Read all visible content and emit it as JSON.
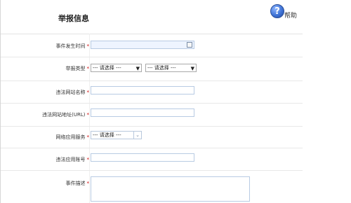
{
  "header": {
    "title": "举报信息",
    "help_icon": "help-circle-icon",
    "help_label": "帮助"
  },
  "form": {
    "required_mark": "*",
    "event_time": {
      "label": "事件发生时间",
      "value": "",
      "icon": "calendar-icon"
    },
    "report_type": {
      "label": "举报类型",
      "selected_1": "--- 请选择 ---",
      "selected_2": "--- 请选择 ---"
    },
    "site_name": {
      "label": "违法网站名称",
      "value": ""
    },
    "site_url": {
      "label": "违法网站地址(URL)",
      "value": ""
    },
    "net_app_service": {
      "label": "网络应用服务",
      "selected": "--- 请选择 ---"
    },
    "app_account": {
      "label": "违法应用账号",
      "value": ""
    },
    "description": {
      "label": "事件描述",
      "value": ""
    }
  }
}
